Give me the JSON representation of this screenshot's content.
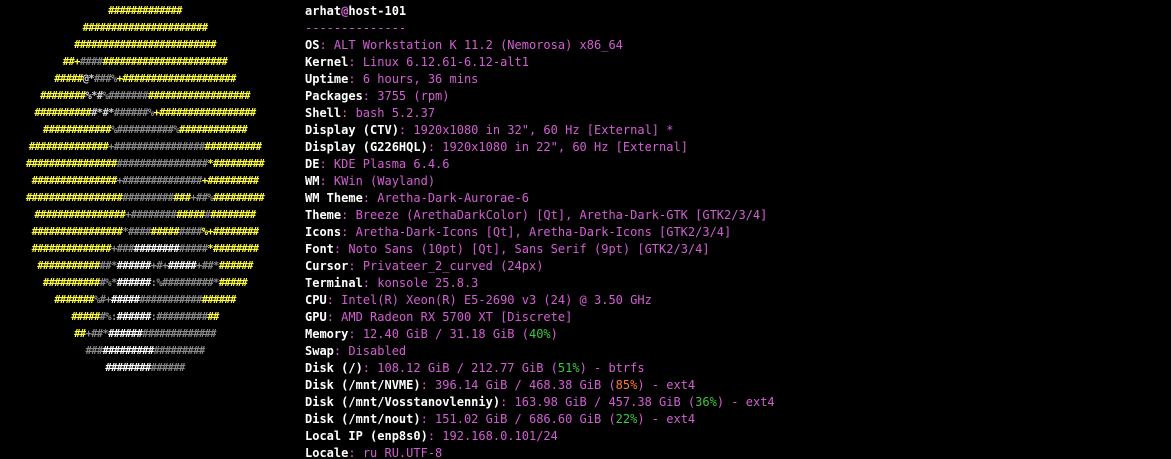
{
  "title": {
    "user": "arhat",
    "at": "@",
    "host": "host-101"
  },
  "separator": "--------------",
  "logo": {
    "lines": [
      [
        {
          "t": "#############",
          "c": "y"
        }
      ],
      [
        {
          "t": "######################",
          "c": "y"
        }
      ],
      [
        {
          "t": "#########################",
          "c": "y"
        }
      ],
      [
        {
          "t": "##+",
          "c": "y"
        },
        {
          "t": "####",
          "c": "g2"
        },
        {
          "t": "######################",
          "c": "y"
        }
      ],
      [
        {
          "t": "#####",
          "c": "y"
        },
        {
          "t": "@*",
          "c": "g1"
        },
        {
          "t": "###%",
          "c": "g2"
        },
        {
          "t": "+####################",
          "c": "y"
        }
      ],
      [
        {
          "t": "########",
          "c": "y"
        },
        {
          "t": "%*#",
          "c": "g1"
        },
        {
          "t": "%#######",
          "c": "g2"
        },
        {
          "t": "##################",
          "c": "y"
        }
      ],
      [
        {
          "t": "##########",
          "c": "y"
        },
        {
          "t": "#*#*",
          "c": "g1"
        },
        {
          "t": "######%",
          "c": "g2"
        },
        {
          "t": "+#################",
          "c": "y"
        }
      ],
      [
        {
          "t": "############",
          "c": "y"
        },
        {
          "t": "%##########%",
          "c": "g2"
        },
        {
          "t": "############",
          "c": "y"
        }
      ],
      [
        {
          "t": "##############",
          "c": "y"
        },
        {
          "t": "+################",
          "c": "g2"
        },
        {
          "t": "##########",
          "c": "y"
        }
      ],
      [
        {
          "t": "################",
          "c": "y"
        },
        {
          "t": "################",
          "c": "g2"
        },
        {
          "t": "*#########",
          "c": "y"
        }
      ],
      [
        {
          "t": "###############",
          "c": "y"
        },
        {
          "t": "+##############",
          "c": "g2"
        },
        {
          "t": "+#########",
          "c": "y"
        }
      ],
      [
        {
          "t": "#################",
          "c": "y"
        },
        {
          "t": "#########",
          "c": "g2"
        },
        {
          "t": "###",
          "c": "y"
        },
        {
          "t": "+##%",
          "c": "g2"
        },
        {
          "t": "#########",
          "c": "y"
        }
      ],
      [
        {
          "t": "################",
          "c": "y"
        },
        {
          "t": "+########",
          "c": "g2"
        },
        {
          "t": "#####",
          "c": "y"
        },
        {
          "t": "#",
          "c": "g2"
        },
        {
          "t": "########",
          "c": "y"
        }
      ],
      [
        {
          "t": "################",
          "c": "y"
        },
        {
          "t": "*####",
          "c": "g2"
        },
        {
          "t": "#####",
          "c": "y"
        },
        {
          "t": "####",
          "c": "g2"
        },
        {
          "t": "%+########",
          "c": "y"
        }
      ],
      [
        {
          "t": "##############",
          "c": "y"
        },
        {
          "t": "+###",
          "c": "g2"
        },
        {
          "t": "########",
          "c": "w"
        },
        {
          "t": "#####",
          "c": "g2"
        },
        {
          "t": "*########",
          "c": "y"
        }
      ],
      [
        {
          "t": "###########",
          "c": "y"
        },
        {
          "t": "##*",
          "c": "g2"
        },
        {
          "t": "######",
          "c": "w"
        },
        {
          "t": "+#+",
          "c": "g2"
        },
        {
          "t": "#####",
          "c": "w"
        },
        {
          "t": "+##*",
          "c": "g2"
        },
        {
          "t": "######",
          "c": "y"
        }
      ],
      [
        {
          "t": "##########",
          "c": "y"
        },
        {
          "t": "#%*",
          "c": "g2"
        },
        {
          "t": "######",
          "c": "w"
        },
        {
          "t": ":%######",
          "c": "g2"
        },
        {
          "t": "###*",
          "c": "g2"
        },
        {
          "t": "#####",
          "c": "y"
        }
      ],
      [
        {
          "t": "#######",
          "c": "y"
        },
        {
          "t": "%#+",
          "c": "g2"
        },
        {
          "t": "#####",
          "c": "w"
        },
        {
          "t": "###########",
          "c": "g2"
        },
        {
          "t": "######",
          "c": "y"
        }
      ],
      [
        {
          "t": "#####",
          "c": "y"
        },
        {
          "t": "#%:",
          "c": "g2"
        },
        {
          "t": "######",
          "c": "w"
        },
        {
          "t": ":#########",
          "c": "g2"
        },
        {
          "t": "##",
          "c": "y"
        }
      ],
      [
        {
          "t": "##",
          "c": "y"
        },
        {
          "t": "+##*",
          "c": "g2"
        },
        {
          "t": "######",
          "c": "w"
        },
        {
          "t": "#############",
          "c": "g2"
        }
      ],
      [
        {
          "t": "###",
          "c": "g2"
        },
        {
          "t": "#########",
          "c": "w"
        },
        {
          "t": "#########",
          "c": "g2"
        }
      ],
      [
        {
          "t": "########",
          "c": "w"
        },
        {
          "t": "######",
          "c": "g2"
        }
      ]
    ]
  },
  "info": [
    {
      "key": "OS",
      "value": "ALT Workstation K 11.2 (Nemorosa) x86_64"
    },
    {
      "key": "Kernel",
      "value": "Linux 6.12.61-6.12-alt1"
    },
    {
      "key": "Uptime",
      "value": "6 hours, 36 mins"
    },
    {
      "key": "Packages",
      "value": "3755 (rpm)"
    },
    {
      "key": "Shell",
      "value": "bash 5.2.37"
    },
    {
      "key": "Display (CTV)",
      "value": "1920x1080 in 32\", 60 Hz [External] *"
    },
    {
      "key": "Display (G226HQL)",
      "value": "1920x1080 in 22\", 60 Hz [External]"
    },
    {
      "key": "DE",
      "value": "KDE Plasma 6.4.6"
    },
    {
      "key": "WM",
      "value": "KWin (Wayland)"
    },
    {
      "key": "WM Theme",
      "value": "Aretha-Dark-Aurorae-6"
    },
    {
      "key": "Theme",
      "value": "Breeze (ArethaDarkColor) [Qt], Aretha-Dark-GTK [GTK2/3/4]"
    },
    {
      "key": "Icons",
      "value": "Aretha-Dark-Icons [Qt], Aretha-Dark-Icons [GTK2/3/4]"
    },
    {
      "key": "Font",
      "value": "Noto Sans (10pt) [Qt], Sans Serif (9pt) [GTK2/3/4]"
    },
    {
      "key": "Cursor",
      "value": "Privateer_2_curved (24px)"
    },
    {
      "key": "Terminal",
      "value": "konsole 25.8.3"
    },
    {
      "key": "CPU",
      "value": "Intel(R) Xeon(R) E5-2690 v3 (24) @ 3.50 GHz"
    },
    {
      "key": "GPU",
      "value": "AMD Radeon RX 5700 XT [Discrete]"
    },
    {
      "key": "Memory",
      "value": "12.40 GiB / 31.18 GiB (",
      "pct": "40%",
      "pct_color": "green",
      "suffix": ")"
    },
    {
      "key": "Swap",
      "value": "Disabled"
    },
    {
      "key": "Disk (/)",
      "value": "108.12 GiB / 212.77 GiB (",
      "pct": "51%",
      "pct_color": "green",
      "suffix": ") - btrfs"
    },
    {
      "key": "Disk (/mnt/NVME)",
      "value": "396.14 GiB / 468.38 GiB (",
      "pct": "85%",
      "pct_color": "orange",
      "suffix": ") - ext4"
    },
    {
      "key": "Disk (/mnt/Vosstanovlenniy)",
      "value": "163.98 GiB / 457.38 GiB (",
      "pct": "36%",
      "pct_color": "green",
      "suffix": ") - ext4"
    },
    {
      "key": "Disk (/mnt/nout)",
      "value": "151.02 GiB / 686.60 GiB (",
      "pct": "22%",
      "pct_color": "green",
      "suffix": ") - ext4"
    },
    {
      "key": "Local IP (enp8s0)",
      "value": "192.168.0.101/24"
    },
    {
      "key": "Locale",
      "value": "ru_RU.UTF-8"
    }
  ],
  "colors": {
    "background": "#000000",
    "logo_yellow": "#ffff3c",
    "logo_light": "#d4d4d4",
    "logo_gray": "#8a8a8a",
    "logo_white": "#ffffff",
    "key": "#ffffff",
    "value": "#d25fd2",
    "pct_green": "#3cc83c",
    "pct_orange": "#ff7a2a"
  }
}
